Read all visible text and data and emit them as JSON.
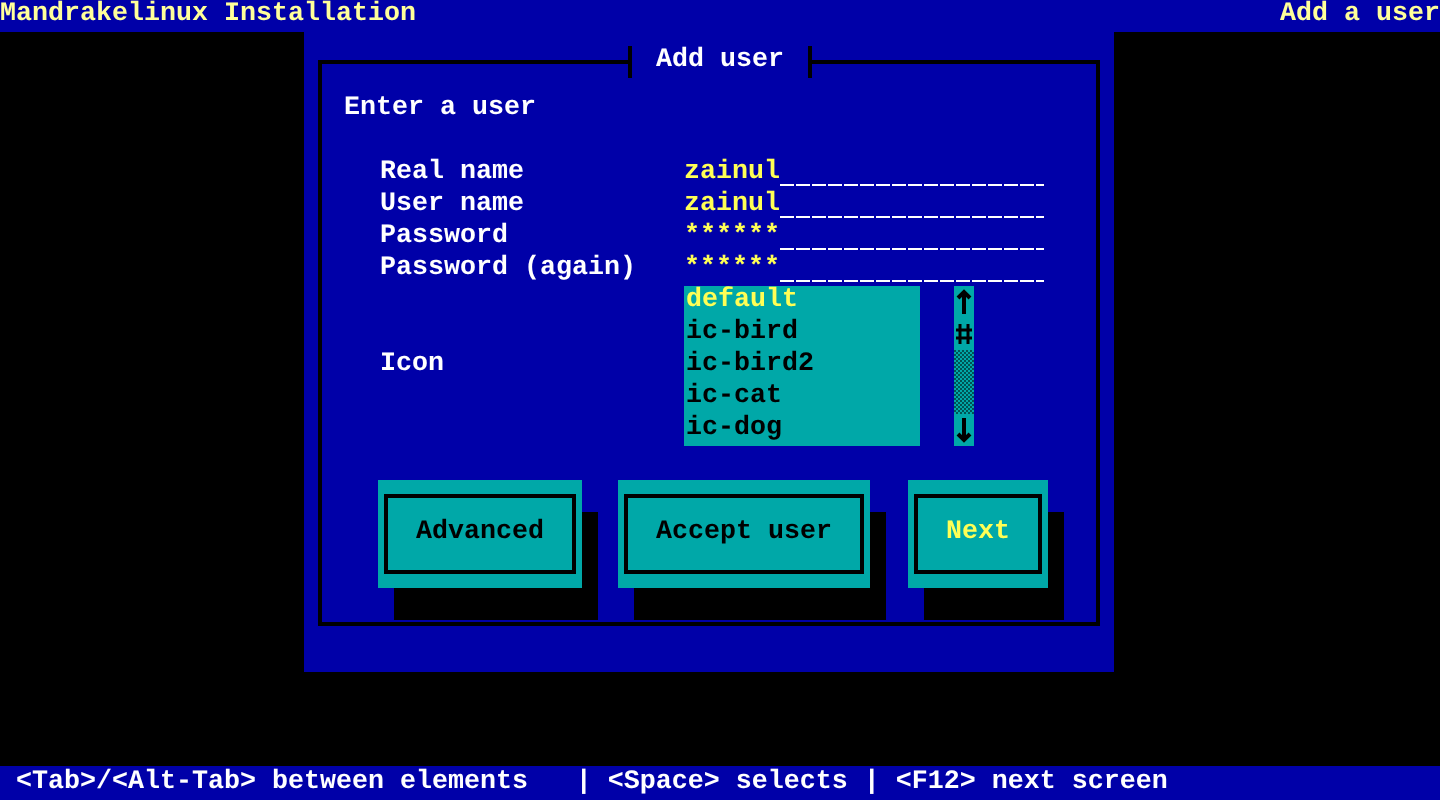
{
  "top_bar": {
    "title": "Mandrakelinux Installation",
    "step": "Add a user"
  },
  "dialog": {
    "title": "Add user",
    "prompt": "Enter a user",
    "fields": [
      {
        "label": "Real name",
        "value": "zainul"
      },
      {
        "label": "User name",
        "value": "zainul"
      },
      {
        "label": "Password",
        "value": "******"
      },
      {
        "label": "Password (again)",
        "value": "******"
      }
    ],
    "icon_list": {
      "label": "Icon",
      "items": [
        {
          "label": "default",
          "selected": true
        },
        {
          "label": "ic-bird",
          "selected": false
        },
        {
          "label": "ic-bird2",
          "selected": false
        },
        {
          "label": "ic-cat",
          "selected": false
        },
        {
          "label": "ic-dog",
          "selected": false
        }
      ]
    },
    "buttons": [
      {
        "label": "Advanced",
        "focused": false
      },
      {
        "label": "Accept user",
        "focused": false
      },
      {
        "label": "Next",
        "focused": true
      }
    ]
  },
  "status_bar": "<Tab>/<Alt-Tab> between elements   | <Space> selects | <F12> next screen"
}
